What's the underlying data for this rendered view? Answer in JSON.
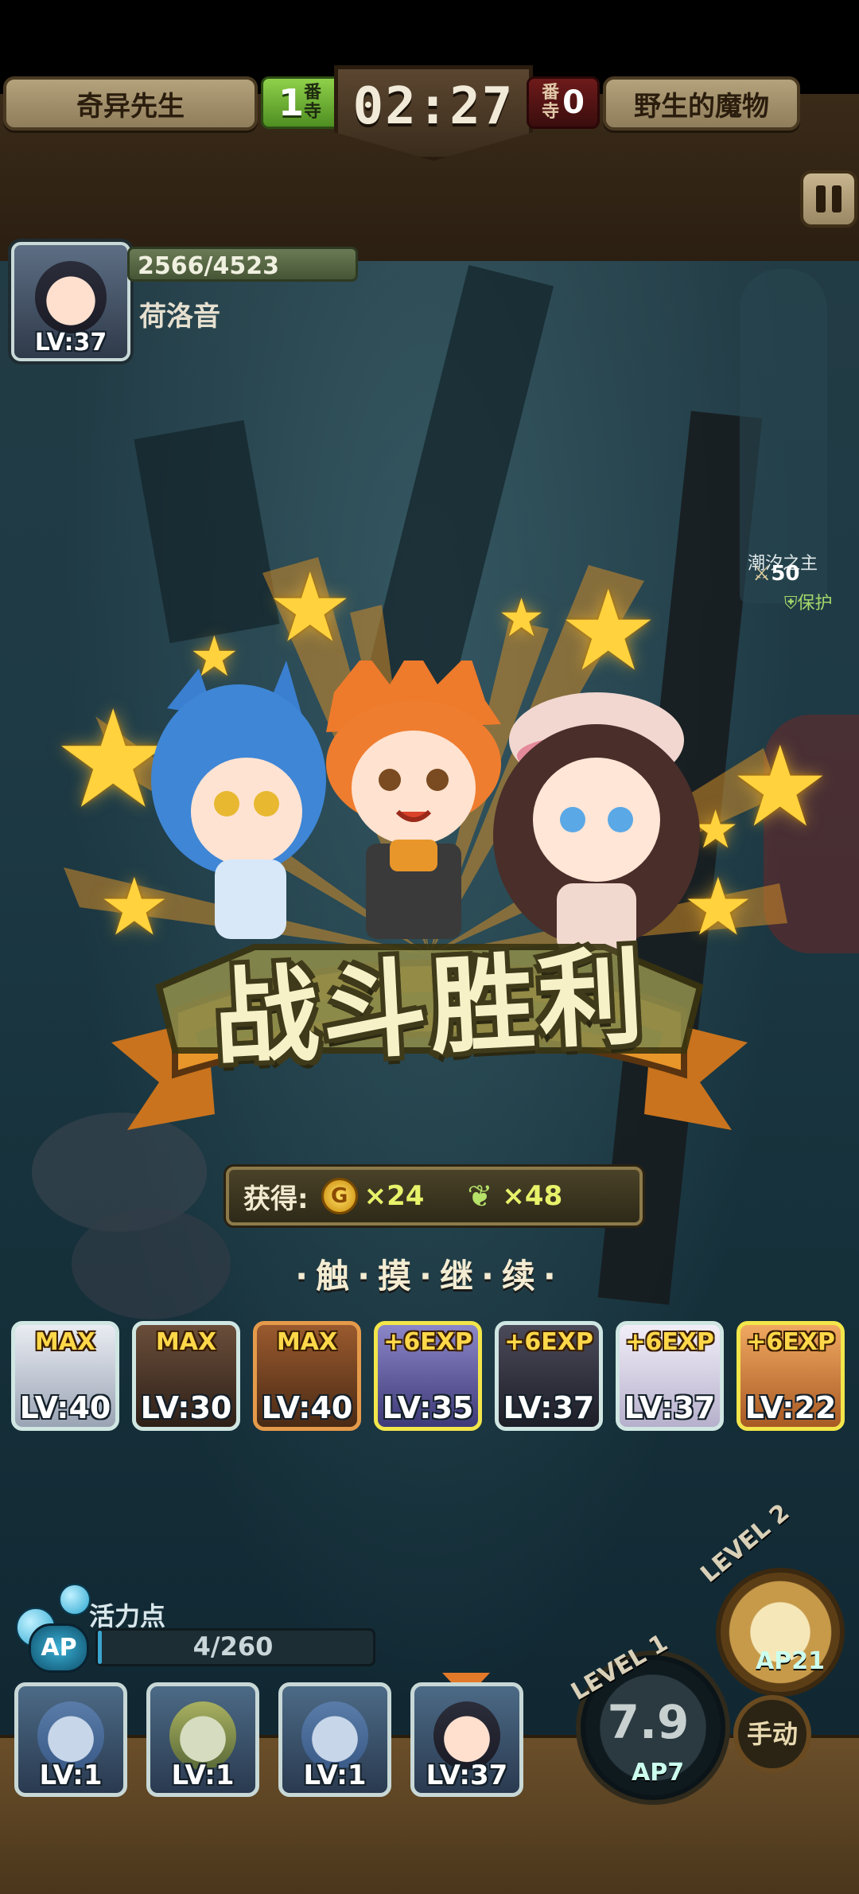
{
  "top": {
    "player_name": "奇异先生",
    "player_score": "1",
    "score_unit": "番寺",
    "timer": "02:27",
    "enemy_score": "0",
    "enemy_name": "野生的魔物"
  },
  "hero": {
    "hp": "2566/4523",
    "name": "荷洛音",
    "level": "LV:37"
  },
  "enemy_tag": {
    "name": "潮汐之主",
    "level": "50",
    "status": "保护"
  },
  "victory": {
    "title": "战斗胜利",
    "reward_label": "获得:",
    "coin_icon": "G",
    "coin_qty": "×24",
    "feather_qty": "×48",
    "tap_hint": "·触·摸·继·续·"
  },
  "exp_row": [
    {
      "tag": "MAX",
      "level": "LV:40",
      "border": "#cfe6e2"
    },
    {
      "tag": "MAX",
      "level": "LV:30",
      "border": "#cfe6e2"
    },
    {
      "tag": "MAX",
      "level": "LV:40",
      "border": "#e59a4a"
    },
    {
      "tag": "+6EXP",
      "level": "LV:35",
      "border": "#f2e64a"
    },
    {
      "tag": "+6EXP",
      "level": "LV:37",
      "border": "#cfe6e2"
    },
    {
      "tag": "+6EXP",
      "level": "LV:37",
      "border": "#cfe6e2"
    },
    {
      "tag": "+6EXP",
      "level": "LV:22",
      "border": "#f2e64a"
    }
  ],
  "ap": {
    "label": "活力点",
    "icon": "AP",
    "value": "4/260",
    "fill": 0.015
  },
  "team": [
    {
      "level": "LV:1"
    },
    {
      "level": "LV:1"
    },
    {
      "level": "LV:1"
    },
    {
      "level": "LV:37"
    }
  ],
  "skills": {
    "level1": "LEVEL 1",
    "dial_value": "7.9",
    "ap7": "AP7",
    "level2": "LEVEL 2",
    "ap21": "AP21",
    "manual": "手动"
  },
  "icons": [
    "pause-icon",
    "coin-icon",
    "feather-icon",
    "ap-icon",
    "gear-icon"
  ],
  "colors": {
    "accent": "#ffd23e",
    "victory": "#f7f1c8",
    "ribbon": "#e8962a"
  }
}
